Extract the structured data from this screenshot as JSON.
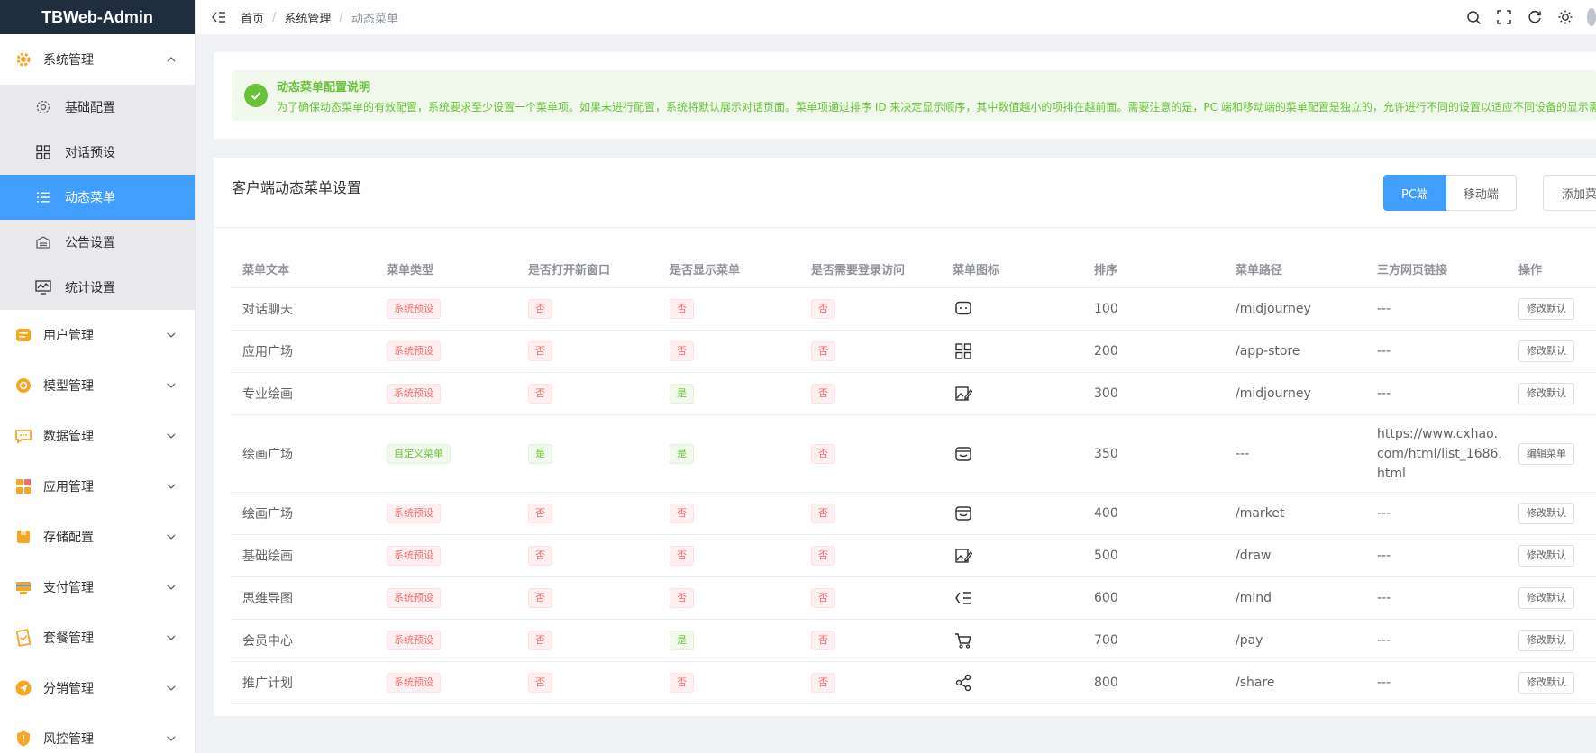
{
  "app": {
    "title": "TBWeb-Admin"
  },
  "sidebar": {
    "groups": [
      {
        "label": "系统管理",
        "icon": "gear-icon",
        "color": "#f5a623",
        "expanded": true
      },
      {
        "label": "用户管理",
        "icon": "user-card-icon",
        "color": "#f5a623"
      },
      {
        "label": "模型管理",
        "icon": "model-icon",
        "color": "#f5a623"
      },
      {
        "label": "数据管理",
        "icon": "chat-data-icon",
        "color": "#f5a623"
      },
      {
        "label": "应用管理",
        "icon": "app-grid-icon",
        "color": "#f5a623"
      },
      {
        "label": "存储配置",
        "icon": "storage-icon",
        "color": "#f5a623"
      },
      {
        "label": "支付管理",
        "icon": "payment-icon",
        "color": "#f5a623"
      },
      {
        "label": "套餐管理",
        "icon": "package-icon",
        "color": "#f5a623"
      },
      {
        "label": "分销管理",
        "icon": "distribution-icon",
        "color": "#f5a623"
      },
      {
        "label": "风控管理",
        "icon": "shield-icon",
        "color": "#f5a623"
      }
    ],
    "sub_items": [
      {
        "label": "基础配置",
        "icon": "gear-outline-icon"
      },
      {
        "label": "对话预设",
        "icon": "grid-icon"
      },
      {
        "label": "动态菜单",
        "icon": "list-icon",
        "active": true
      },
      {
        "label": "公告设置",
        "icon": "announcement-icon"
      },
      {
        "label": "统计设置",
        "icon": "monitor-chart-icon"
      }
    ]
  },
  "topbar": {
    "breadcrumb": [
      "首页",
      "系统管理",
      "动态菜单"
    ],
    "icons": [
      "search-icon",
      "fullscreen-icon",
      "refresh-icon",
      "theme-sun-icon"
    ]
  },
  "notice": {
    "title": "动态菜单配置说明",
    "description": "为了确保动态菜单的有效配置，系统要求至少设置一个菜单项。如果未进行配置，系统将默认展示对话页面。菜单项通过排序 ID 来决定显示顺序，其中数值越小的项排在越前面。需要注意的是，PC 端和移动端的菜单配置是独立的，允许进行不同的设置以适应不同设备的显示需求。"
  },
  "main": {
    "title": "客户端动态菜单设置",
    "segment": [
      "PC端",
      "移动端"
    ],
    "add_label": "添加菜单",
    "colors": {
      "primary": "#409eff",
      "danger": "#f56c6c",
      "success": "#67c23a"
    }
  },
  "table": {
    "headers": [
      "菜单文本",
      "菜单类型",
      "是否打开新窗口",
      "是否显示菜单",
      "是否需要登录访问",
      "菜单图标",
      "排序",
      "菜单路径",
      "三方网页链接",
      "操作"
    ],
    "rows": [
      {
        "text": "对话聊天",
        "type": "系统预设",
        "newWin": "否",
        "show": "否",
        "login": "否",
        "icon": "chat-bubble-icon",
        "order": "100",
        "path": "/midjourney",
        "link": "---",
        "op": "修改默认"
      },
      {
        "text": "应用广场",
        "type": "系统预设",
        "newWin": "否",
        "show": "否",
        "login": "否",
        "icon": "app-grid-icon",
        "order": "200",
        "path": "/app-store",
        "link": "---",
        "op": "修改默认"
      },
      {
        "text": "专业绘画",
        "type": "系统预设",
        "newWin": "否",
        "show": "是",
        "login": "否",
        "icon": "image-edit-icon",
        "order": "300",
        "path": "/midjourney",
        "link": "---",
        "op": "修改默认"
      },
      {
        "text": "绘画广场",
        "type": "自定义菜单",
        "newWin": "是",
        "show": "是",
        "login": "否",
        "icon": "wallet-icon",
        "order": "350",
        "path": "---",
        "link": "https://www.cxhao.com/html/list_1686.html",
        "op": "编辑菜单"
      },
      {
        "text": "绘画广场",
        "type": "系统预设",
        "newWin": "否",
        "show": "否",
        "login": "否",
        "icon": "wallet-icon",
        "order": "400",
        "path": "/market",
        "link": "---",
        "op": "修改默认"
      },
      {
        "text": "基础绘画",
        "type": "系统预设",
        "newWin": "否",
        "show": "否",
        "login": "否",
        "icon": "image-edit-icon",
        "order": "500",
        "path": "/draw",
        "link": "---",
        "op": "修改默认"
      },
      {
        "text": "思维导图",
        "type": "系统预设",
        "newWin": "否",
        "show": "否",
        "login": "否",
        "icon": "mind-map-icon",
        "order": "600",
        "path": "/mind",
        "link": "---",
        "op": "修改默认"
      },
      {
        "text": "会员中心",
        "type": "系统预设",
        "newWin": "否",
        "show": "是",
        "login": "否",
        "icon": "cart-icon",
        "order": "700",
        "path": "/pay",
        "link": "---",
        "op": "修改默认"
      },
      {
        "text": "推广计划",
        "type": "系统预设",
        "newWin": "否",
        "show": "否",
        "login": "否",
        "icon": "share-icon",
        "order": "800",
        "path": "/share",
        "link": "---",
        "op": "修改默认"
      }
    ]
  }
}
